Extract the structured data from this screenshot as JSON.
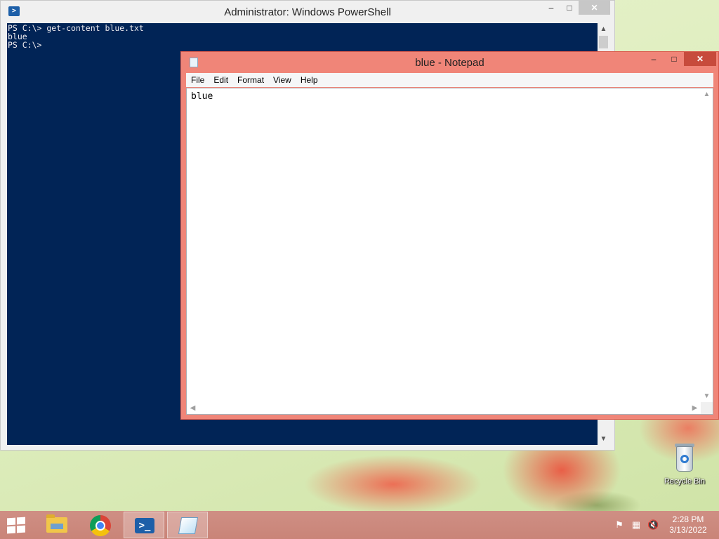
{
  "powershell": {
    "title": "Administrator: Windows PowerShell",
    "icon": "powershell-icon",
    "lines": [
      "PS C:\\> get-content blue.txt",
      "blue",
      "PS C:\\>"
    ]
  },
  "notepad": {
    "title": "blue - Notepad",
    "icon": "notepad-icon",
    "menu": [
      "File",
      "Edit",
      "Format",
      "View",
      "Help"
    ],
    "content": "blue",
    "accent_color": "#f08578"
  },
  "window_controls": {
    "minimize": "–",
    "maximize": "□",
    "close": "✕"
  },
  "desktop": {
    "recycle_bin_label": "Recycle Bin"
  },
  "taskbar": {
    "items": [
      "start-icon",
      "file-explorer-icon",
      "chrome-icon",
      "powershell-icon",
      "notepad-icon"
    ],
    "tray": [
      "action-center-flag-icon",
      "network-icon",
      "volume-muted-icon"
    ],
    "time": "2:28 PM",
    "date": "3/13/2022"
  }
}
